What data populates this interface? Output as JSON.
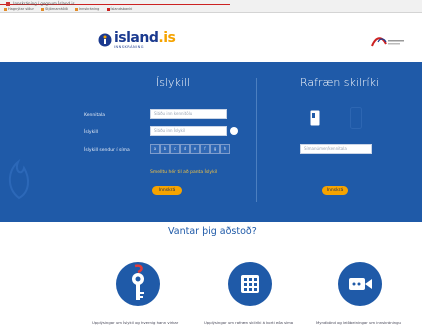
{
  "browser": {
    "tab_title": "Innskráning í gegnum Ísland.is",
    "bookmarks": [
      "Hagnýtar síður",
      "Stjórnarráðið",
      "Innskráning",
      "Íslandsbanki"
    ]
  },
  "header": {
    "logo_text_prefix": "island",
    "logo_text_suffix": ".is",
    "logo_sub": "INNSKRÁNING",
    "sponsor_name": "Þjóðskrá Íslands"
  },
  "islykill": {
    "title": "Íslykill",
    "kennitala_label": "Kennitala",
    "kennitala_placeholder": "Sláðu inn kennitölu",
    "islykill_label": "Íslykill",
    "islykill_placeholder": "Sláðu inn Íslykil",
    "sms_label": "Íslykill sendur í síma",
    "pw_chars": [
      "a",
      "b",
      "c",
      "d",
      "e",
      "f",
      "g",
      "h",
      "i",
      "j"
    ],
    "forgot_link": "Smelltu hér til að panta Íslykil",
    "login_button": "Innskrá"
  },
  "rafraen": {
    "title": "Rafræn skilríki",
    "phone_placeholder": "Símanúmer/kennitala",
    "login_button": "Innskrá"
  },
  "help": {
    "title": "Vantar þig aðstoð?",
    "items": [
      {
        "icon": "key-icon",
        "text": "Upplýsingar um Íslykil og hvernig hann virkar"
      },
      {
        "icon": "building-icon",
        "text": "Upplýsingar um rafræn skilríki á korti eða síma"
      },
      {
        "icon": "video-icon",
        "text": "Myndbönd og leiðbeiningar um innskráningu"
      }
    ]
  },
  "colors": {
    "brand_blue": "#1f5aa8",
    "accent_orange": "#f5a300"
  }
}
